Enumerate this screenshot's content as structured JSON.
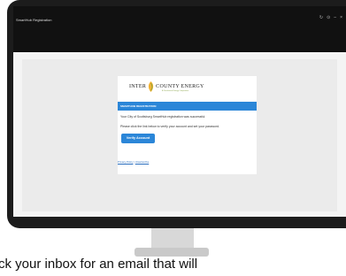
{
  "window": {
    "title": "SmartHub Registration",
    "controls": [
      "↻",
      "⊙",
      "–",
      "×"
    ]
  },
  "email": {
    "logo_left": "INTER",
    "logo_right": "COUNTY ENERGY",
    "logo_tagline": "A Touchstone Energy Cooperative",
    "header": "SMARTHUB REGISTRATION",
    "line1": "Your City of Scottsburg SmartHub registration was successful.",
    "line2": "Please click the link below to verify your account and set your password.",
    "verify_button": "Verify Account",
    "link_privacy": "Privacy Policy",
    "link_separator": " | ",
    "link_unsubscribe": "Unsubscribe"
  },
  "caption": "ck your inbox for an email that will",
  "colors": {
    "accent": "#2b86d8",
    "bezel": "#1c1c1c",
    "titlebar": "#111111"
  }
}
